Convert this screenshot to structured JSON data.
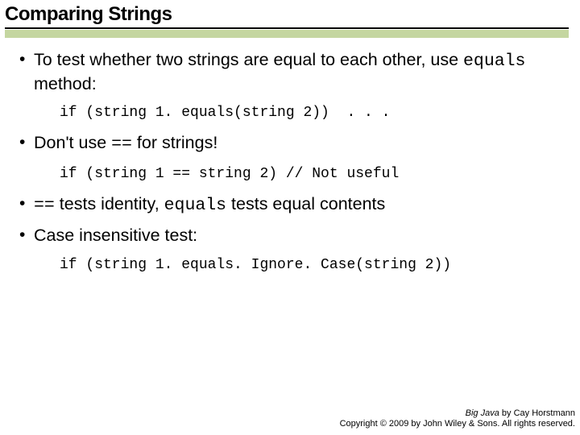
{
  "title": "Comparing Strings",
  "bullets": {
    "b1_pre": "To test whether two strings are equal to each other, use ",
    "b1_code": "equals",
    "b1_post": " method:",
    "code1": "if (string 1. equals(string 2))  . . .",
    "b2_pre": "Don't use ",
    "b2_code": "==",
    "b2_post": " for strings!",
    "code2": "if (string 1 == string 2) // Not useful",
    "b3_code1": "==",
    "b3_mid": " tests identity, ",
    "b3_code2": "equals",
    "b3_post": " tests equal contents",
    "b4": "Case insensitive test:",
    "code3": "if (string 1. equals. Ignore. Case(string 2))"
  },
  "footer": {
    "book": "Big Java",
    "by": " by Cay Horstmann",
    "copyright": "Copyright © 2009 by John Wiley & Sons.  All rights reserved."
  }
}
